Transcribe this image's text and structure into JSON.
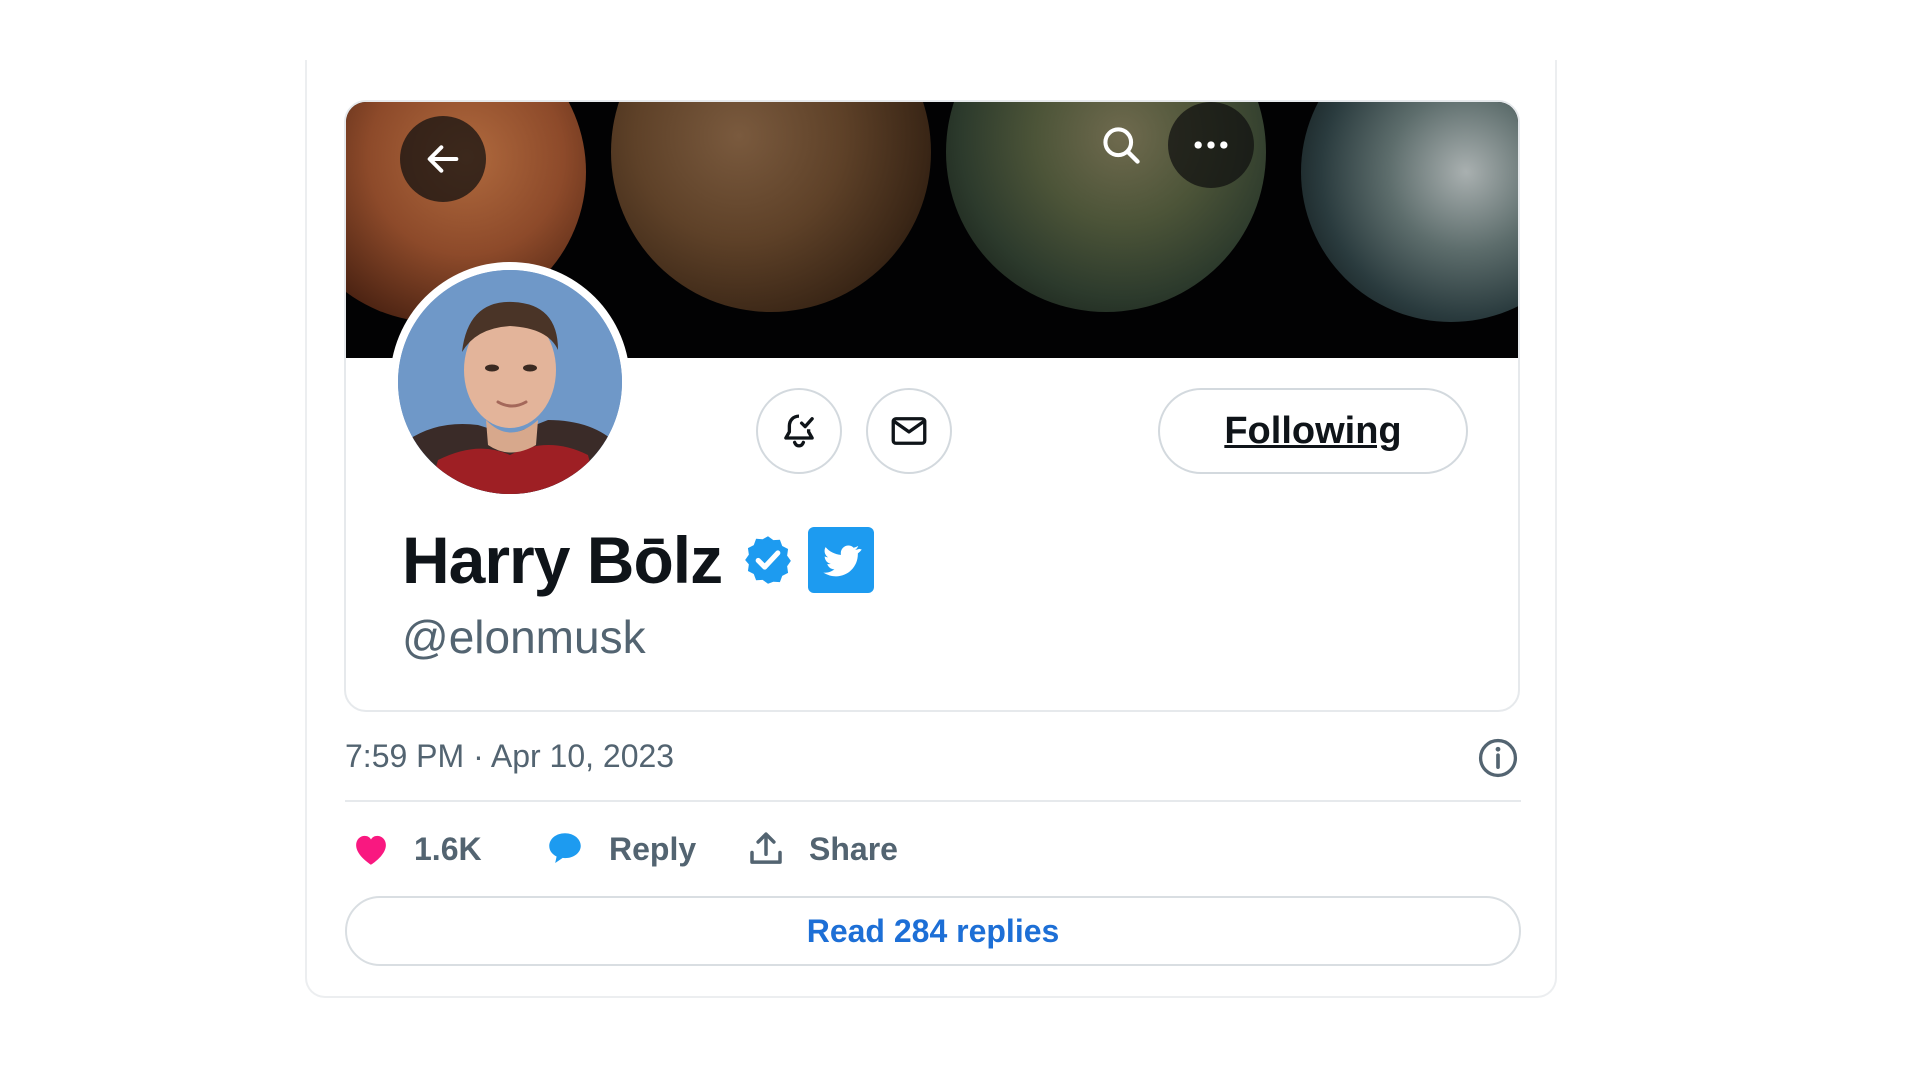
{
  "profile": {
    "display_name": "Harry Bōlz",
    "handle": "@elonmusk",
    "following_label": "Following"
  },
  "tweet": {
    "timestamp": "7:59 PM · Apr 10, 2023",
    "likes": "1.6K",
    "reply_label": "Reply",
    "share_label": "Share",
    "read_replies_label": "Read 284 replies"
  },
  "icons": {
    "back": "arrow-left-icon",
    "search": "search-icon",
    "more": "more-horizontal-icon",
    "notifications": "bell-check-icon",
    "message": "envelope-icon",
    "verified": "verified-badge-icon",
    "twitter": "twitter-bird-icon",
    "info": "info-icon",
    "like": "heart-icon",
    "reply": "speech-bubble-icon",
    "share": "upload-share-icon"
  },
  "colors": {
    "verified_blue": "#1d9bf0",
    "like_pink": "#f91880",
    "link_blue": "#1d6fd6",
    "text_primary": "#0f1419",
    "text_secondary": "#536471"
  }
}
